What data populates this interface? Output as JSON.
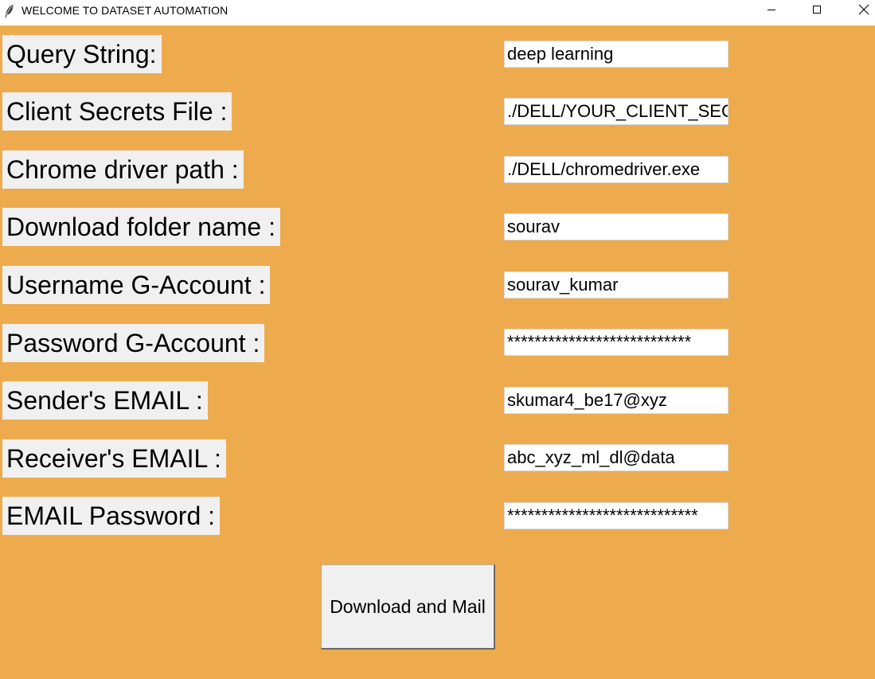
{
  "window": {
    "title": "WELCOME TO DATASET AUTOMATION",
    "icon": "feather-icon",
    "controls": {
      "minimize_icon": "minimize-icon",
      "maximize_icon": "maximize-icon",
      "close_icon": "close-icon"
    }
  },
  "colors": {
    "background": "#EDAB4E",
    "label_background": "#F0F0F0",
    "entry_background": "#FFFFFF"
  },
  "form": {
    "fields": [
      {
        "label": "Query String:",
        "value": "deep learning"
      },
      {
        "label": "Client Secrets File :",
        "value": "./DELL/YOUR_CLIENT_SECRETS"
      },
      {
        "label": "Chrome driver path :",
        "value": "./DELL/chromedriver.exe"
      },
      {
        "label": "Download folder name :",
        "value": "sourav"
      },
      {
        "label": "Username G-Account :",
        "value": "sourav_kumar"
      },
      {
        "label": "Password G-Account :",
        "value": "***************************"
      },
      {
        "label": "Sender's EMAIL :",
        "value": "skumar4_be17@xyz"
      },
      {
        "label": "Receiver's EMAIL :",
        "value": "abc_xyz_ml_dl@data"
      },
      {
        "label": "EMAIL Password :",
        "value": "****************************"
      }
    ],
    "submit_label": "Download and Mail"
  }
}
